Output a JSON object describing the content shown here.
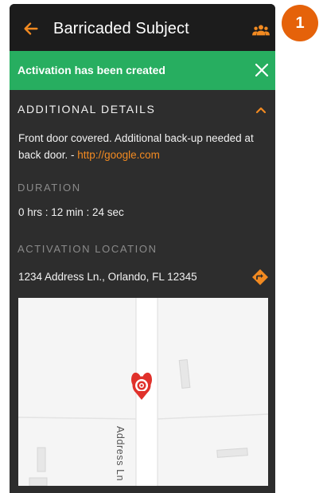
{
  "header": {
    "title": "Barricaded Subject",
    "back_icon": "arrow-left-icon",
    "team_icon": "people-group-icon"
  },
  "banner": {
    "message": "Activation has been created",
    "close_icon": "close-icon",
    "color": "#27ae60"
  },
  "additional_details": {
    "heading": "ADDITIONAL DETAILS",
    "collapse_icon": "chevron-up-icon",
    "text": "Front door covered. Additional back-up needed at back door. - ",
    "link": "http://google.com"
  },
  "duration": {
    "heading": "DURATION",
    "value": "0 hrs : 12 min : 24 sec"
  },
  "location": {
    "heading": "ACTIVATION LOCATION",
    "address": "1234 Address Ln., Orlando, FL 12345",
    "directions_icon": "directions-icon"
  },
  "map": {
    "road_label": "Address Ln",
    "pin_icon": "map-pin-icon"
  },
  "step_badge": "1",
  "colors": {
    "accent": "#f28a21",
    "badge": "#e5620a",
    "background": "#2d2d2d",
    "topbar": "#1c1c1c"
  }
}
